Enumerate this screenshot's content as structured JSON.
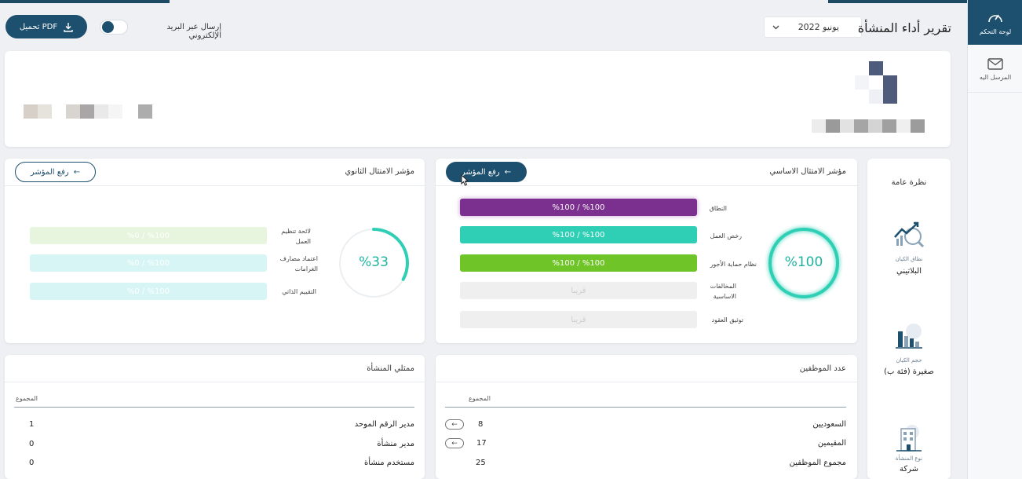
{
  "sidebar": {
    "items": [
      {
        "label": "لوحة التحكم",
        "icon": "gauge-icon"
      },
      {
        "label": "المرسل اليه",
        "icon": "mail-icon"
      }
    ]
  },
  "header": {
    "title": "تقرير أداء المنشأة",
    "period": "يونيو 2022",
    "email_toggle_label": "إرسال عبر البريد الإلكتروني",
    "pdf_button": "تحميل PDF"
  },
  "overview": {
    "title": "نظرة عامة",
    "items": [
      {
        "label": "نطاق الكيان",
        "value": "البلاتيني",
        "icon": "growth-chart-icon"
      },
      {
        "label": "حجم الكيان",
        "value": "صغيرة (فئة ب)",
        "icon": "bar-chart-icon"
      },
      {
        "label": "نوع المنشأة",
        "value": "شركة",
        "icon": "building-icon"
      }
    ]
  },
  "primary_compliance": {
    "title": "مؤشر الامتثال الاساسي",
    "button": "رفع المؤشر",
    "percent": "%100",
    "ring_fraction": 1.0,
    "ring_color": "#2ecfb4",
    "bars": [
      {
        "label": "النطاق",
        "value": "%100",
        "total": "%100",
        "color": "#7b2f8e"
      },
      {
        "label": "رخص العمل",
        "value": "%100",
        "total": "%100",
        "color": "#2ecfb4"
      },
      {
        "label": "نظام حماية الأجور",
        "value": "%100",
        "total": "%100",
        "color": "#6fc427"
      },
      {
        "label": "المخالفات الاساسية",
        "value": "قريبا",
        "total": "",
        "color": "#efefef"
      },
      {
        "label": "توثيق العقود",
        "value": "قريبا",
        "total": "",
        "color": "#efefef"
      }
    ]
  },
  "secondary_compliance": {
    "title": "مؤشر الامتثال الثانوي",
    "button": "رفع المؤشر",
    "percent": "%33",
    "ring_fraction": 0.33,
    "ring_color": "#2ecfb4",
    "bars": [
      {
        "label": "لائحة تنظيم العمل",
        "value": "%0",
        "total": "%100",
        "color": "#e8f5de"
      },
      {
        "label": "اعتماد مصارف الغرامات",
        "value": "%0",
        "total": "%100",
        "color": "#d7f5f4"
      },
      {
        "label": "التقييم الذاتي",
        "value": "%0",
        "total": "%100",
        "color": "#d7f5f4"
      }
    ]
  },
  "employees": {
    "title": "عدد الموظفين",
    "column": "المجموع",
    "rows": [
      {
        "label": "السعوديين",
        "value": "8"
      },
      {
        "label": "المقيمين",
        "value": "17"
      },
      {
        "label": "مجموع الموظفين",
        "value": "25"
      }
    ]
  },
  "representatives": {
    "title": "ممثلي المنشأة",
    "column": "المجموع",
    "rows": [
      {
        "label": "مدير الرقم الموحد",
        "value": "1"
      },
      {
        "label": "مدير منشأة",
        "value": "0"
      },
      {
        "label": "مستخدم منشأة",
        "value": "0"
      }
    ]
  }
}
